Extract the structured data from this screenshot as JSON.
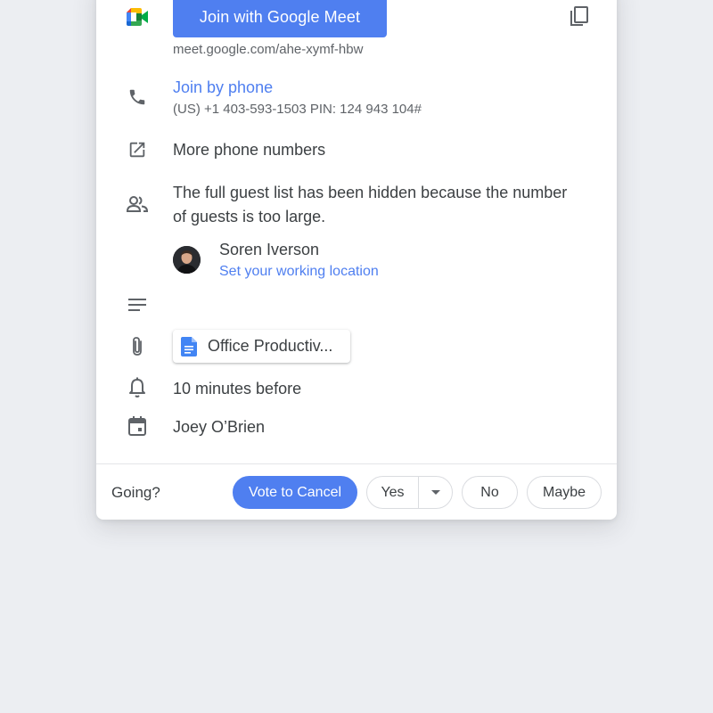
{
  "conferencing": {
    "join_button": "Join with Google Meet",
    "url": "meet.google.com/ahe-xymf-hbw",
    "icon": "google-meet-icon",
    "copy_icon": "copy-icon"
  },
  "phone": {
    "join_label": "Join by phone",
    "details": "(US) +1 403-593-1503 PIN: 124 943 104#",
    "icon": "phone-icon"
  },
  "more_numbers": {
    "label": "More phone numbers",
    "icon": "open-in-new-icon"
  },
  "guests": {
    "notice": [
      "The full guest list has been hidden because the number",
      "of guests is too large."
    ],
    "icon": "people-icon",
    "person": {
      "name": "Soren Iverson",
      "action": "Set your working location"
    }
  },
  "description": {
    "icon": "notes-icon"
  },
  "attachment": {
    "label": "Office Productiv...",
    "icon": "google-docs-icon",
    "row_icon": "paperclip-icon"
  },
  "reminder": {
    "label": "10 minutes before",
    "icon": "bell-icon"
  },
  "organizer": {
    "label": "Joey O’Brien",
    "icon": "calendar-icon"
  },
  "rsvp": {
    "prompt": "Going?",
    "vote_cancel": "Vote to Cancel",
    "yes": "Yes",
    "no": "No",
    "maybe": "Maybe"
  },
  "colors": {
    "accent": "#4f7ff0",
    "text": "#3c4043",
    "secondary_text": "#5f6368",
    "icon": "#5f6368",
    "background": "#eceef2"
  }
}
